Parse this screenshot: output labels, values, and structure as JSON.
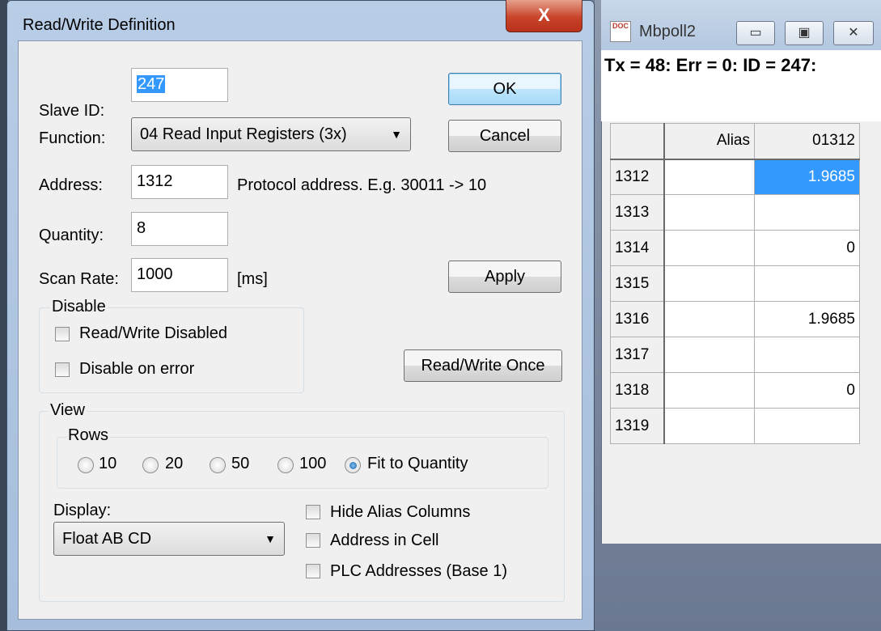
{
  "dialog": {
    "title": "Read/Write Definition",
    "close_label": "X",
    "slave_id": {
      "label": "Slave ID:",
      "value": "247"
    },
    "function": {
      "label": "Function:",
      "value": "04 Read Input Registers (3x)"
    },
    "address": {
      "label": "Address:",
      "value": "1312",
      "hint": "Protocol address. E.g. 30011 -> 10"
    },
    "quantity": {
      "label": "Quantity:",
      "value": "8"
    },
    "scan_rate": {
      "label": "Scan Rate:",
      "value": "1000",
      "unit": "[ms]"
    },
    "buttons": {
      "ok": "OK",
      "cancel": "Cancel",
      "apply": "Apply",
      "read_write_once": "Read/Write Once"
    },
    "disable_group": {
      "legend": "Disable",
      "read_write_disabled": {
        "label": "Read/Write Disabled",
        "checked": false
      },
      "disable_on_error": {
        "label": "Disable on error",
        "checked": false
      }
    },
    "view_group": {
      "legend": "View",
      "rows": {
        "legend": "Rows",
        "options": [
          "10",
          "20",
          "50",
          "100",
          "Fit to Quantity"
        ],
        "selected": "Fit to Quantity"
      },
      "display": {
        "label": "Display:",
        "value": "Float AB CD"
      },
      "hide_alias_columns": {
        "label": "Hide Alias Columns",
        "checked": false
      },
      "address_in_cell": {
        "label": "Address in Cell",
        "checked": false
      },
      "plc_addresses": {
        "label": "PLC Addresses (Base 1)",
        "checked": false
      }
    }
  },
  "mbpoll": {
    "title": "Mbpoll2",
    "icon_text": "DOC",
    "status": "Tx = 48: Err = 0: ID = 247:",
    "grid": {
      "headers": [
        "",
        "Alias",
        "01312"
      ],
      "rows": [
        {
          "addr": "1312",
          "alias": "",
          "value": "1.9685"
        },
        {
          "addr": "1313",
          "alias": "",
          "value": ""
        },
        {
          "addr": "1314",
          "alias": "",
          "value": "0"
        },
        {
          "addr": "1315",
          "alias": "",
          "value": ""
        },
        {
          "addr": "1316",
          "alias": "",
          "value": "1.9685"
        },
        {
          "addr": "1317",
          "alias": "",
          "value": ""
        },
        {
          "addr": "1318",
          "alias": "",
          "value": "0"
        },
        {
          "addr": "1319",
          "alias": "",
          "value": ""
        }
      ]
    }
  },
  "colors": {
    "selection": "#3399ff",
    "close_button": "#c8442a",
    "title_bar": "#b8cde6"
  }
}
